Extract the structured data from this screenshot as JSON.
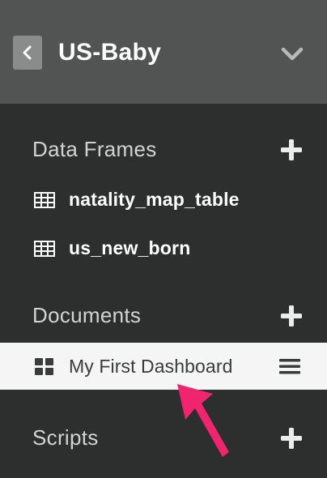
{
  "header": {
    "project_title": "US-Baby",
    "back_icon": "chevron-left-icon",
    "dropdown_icon": "chevron-down-icon"
  },
  "sections": {
    "data_frames": {
      "title": "Data Frames",
      "add_icon": "plus-icon",
      "items": [
        {
          "label": "natality_map_table",
          "icon": "table-icon"
        },
        {
          "label": "us_new_born",
          "icon": "table-icon"
        }
      ]
    },
    "documents": {
      "title": "Documents",
      "add_icon": "plus-icon",
      "items": [
        {
          "label": "My First Dashboard",
          "icon": "dashboard-icon",
          "menu_icon": "hamburger-menu-icon",
          "selected": true
        }
      ]
    },
    "scripts": {
      "title": "Scripts",
      "add_icon": "plus-icon"
    }
  },
  "colors": {
    "sidebar_bg": "#2d2e2e",
    "header_bg": "#525454",
    "selected_row_bg": "#f5f5f5",
    "annotation_arrow": "#f0246f"
  }
}
